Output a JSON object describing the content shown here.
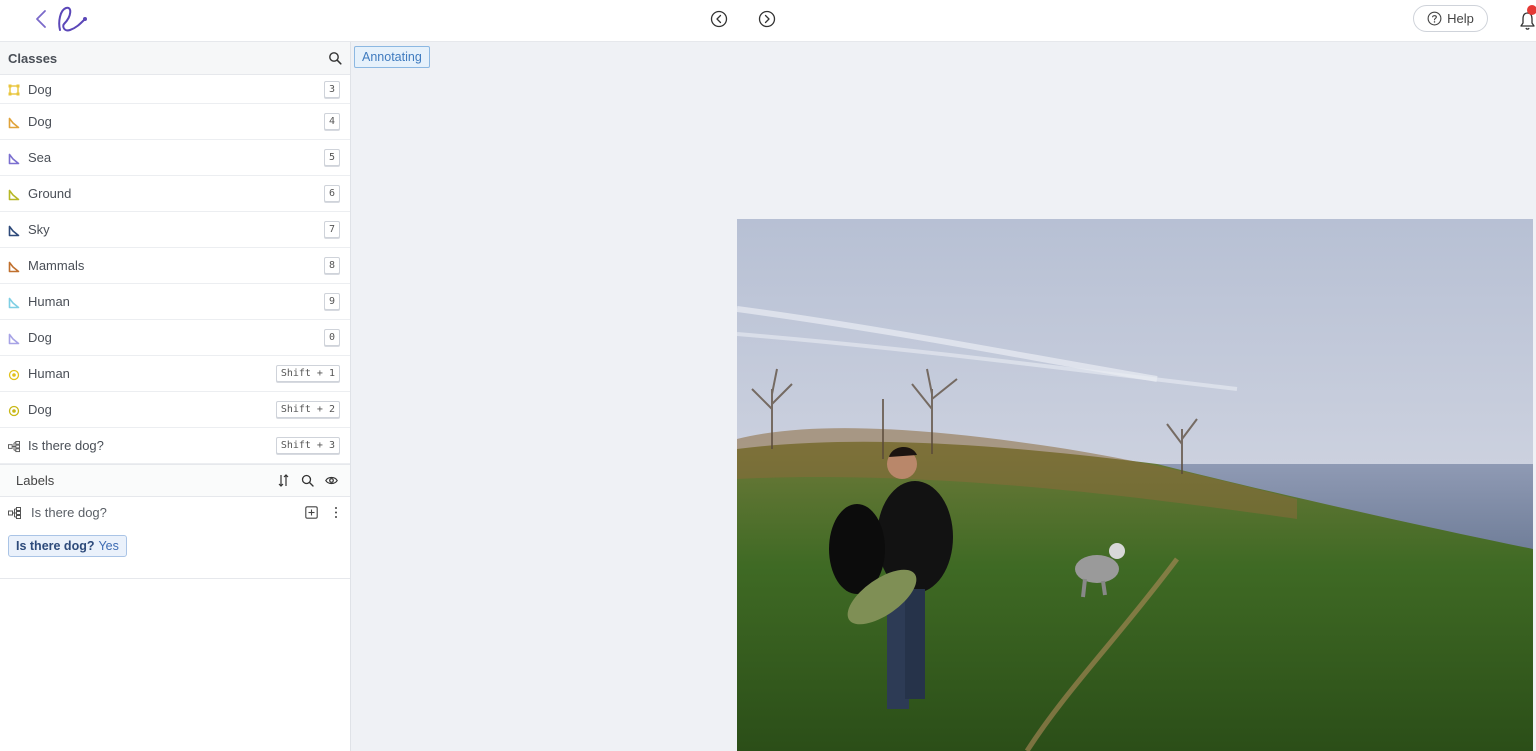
{
  "header": {
    "prev_icon": "chevron-left-circle-icon",
    "next_icon": "chevron-right-circle-icon",
    "help_label": "Help"
  },
  "sidebar": {
    "classes_title": "Classes",
    "classes": [
      {
        "name": "Dog",
        "shortcut": "3",
        "type": "bounding-box",
        "color": "#e8c53c"
      },
      {
        "name": "Dog",
        "shortcut": "4",
        "type": "polygon",
        "color": "#e0a33a"
      },
      {
        "name": "Sea",
        "shortcut": "5",
        "type": "polygon",
        "color": "#7b6fd0"
      },
      {
        "name": "Ground",
        "shortcut": "6",
        "type": "polygon",
        "color": "#b7b826"
      },
      {
        "name": "Sky",
        "shortcut": "7",
        "type": "polygon",
        "color": "#2e4a7a"
      },
      {
        "name": "Mammals",
        "shortcut": "8",
        "type": "polygon",
        "color": "#c0702e"
      },
      {
        "name": "Human",
        "shortcut": "9",
        "type": "polygon",
        "color": "#7fcfe4"
      },
      {
        "name": "Dog",
        "shortcut": "0",
        "type": "polygon",
        "color": "#a7a3e6"
      },
      {
        "name": "Human",
        "shortcut": "Shift + 1",
        "type": "point",
        "color": "#e1c21c"
      },
      {
        "name": "Dog",
        "shortcut": "Shift + 2",
        "type": "point",
        "color": "#c8b816"
      },
      {
        "name": "Is there dog?",
        "shortcut": "Shift + 3",
        "type": "tag",
        "color": "#555555"
      }
    ],
    "labels_title": "Labels",
    "label_item": {
      "name": "Is there dog?",
      "answer_question": "Is there dog?",
      "answer_value": "Yes"
    }
  },
  "canvas": {
    "status": "Annotating"
  }
}
